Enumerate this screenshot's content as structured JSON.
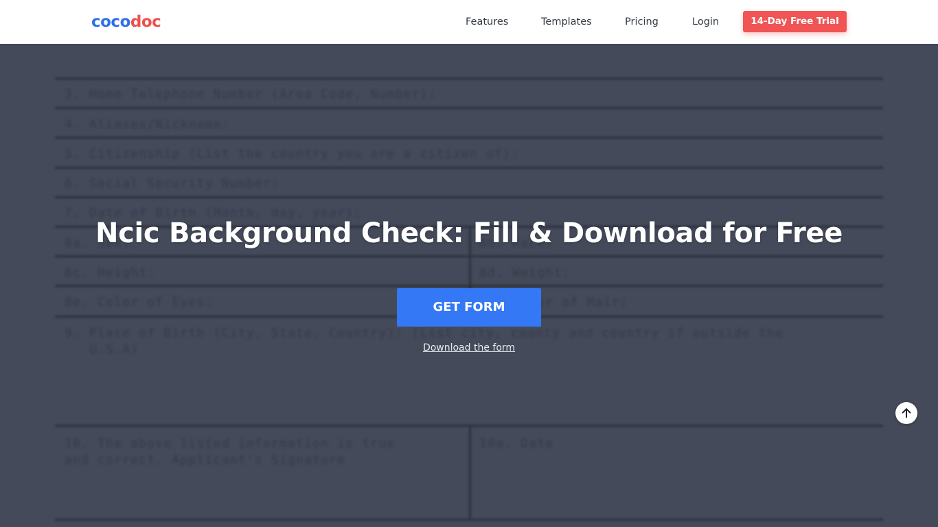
{
  "header": {
    "logo_part1": "coco",
    "logo_part2": "doc",
    "nav": {
      "features": "Features",
      "templates": "Templates",
      "pricing": "Pricing",
      "login": "Login"
    },
    "trial_button": "14-Day Free Trial"
  },
  "form_preview": {
    "line_3": "3. Home Telephone Number (Area Code, Number):",
    "line_4": "4. Aliases/Nickname:",
    "line_5": "5. Citizenship (List the country you are a citizen of):",
    "line_6": "6. Social Security Number:",
    "line_7": "7. Date of Birth (Month, day, year):",
    "line_8a": "8a. Sex:",
    "line_8b": "8b. Race:",
    "line_8c": "8c. Height:",
    "line_8d": "8d. Weight:",
    "line_8e": "8e. Color of Eyes:",
    "line_8f": "8f. Color of Hair:",
    "line_9a": "9. Place of Birth (City, State, Country): (List city, county and country if outside the",
    "line_9b": "   U.S.A)",
    "line_10a": "10. The above listed information is true",
    "line_10b": "and correct. Applicant's Signature",
    "line_10c": "10a. Date"
  },
  "hero": {
    "title": "Ncic Background Check: Fill & Download for Free",
    "get_form_button": "GET FORM",
    "download_link": "Download the form"
  },
  "colors": {
    "brand_blue": "#2f6fe8",
    "brand_red": "#f04f4f",
    "cta_blue": "#3478f6",
    "trial_red": "#f05454",
    "overlay": "#444a5a"
  },
  "icons": {
    "scroll_top": "arrow-up-icon"
  }
}
